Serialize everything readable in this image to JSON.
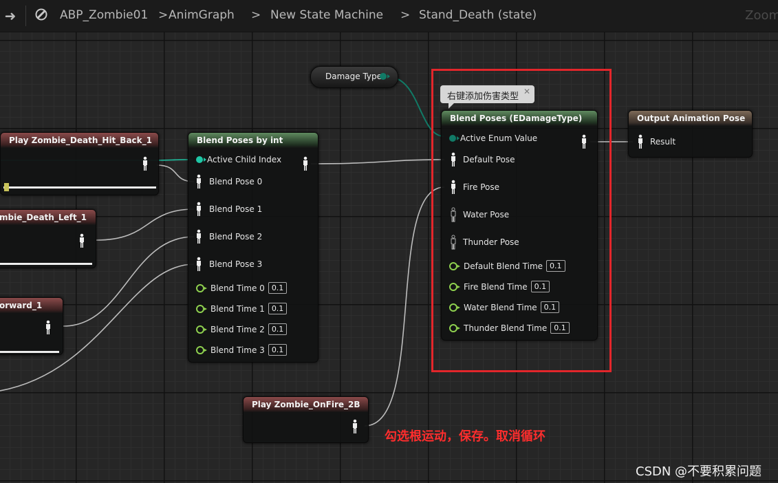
{
  "breadcrumb": {
    "items": [
      "ABP_Zombie01",
      "AnimGraph",
      "New State Machine",
      "Stand_Death (state)"
    ],
    "separator": ">",
    "zoom_label": "Zoom"
  },
  "icons": {
    "back": "back-arrow-icon",
    "blueprint": "blueprint-icon",
    "pose_pin": "pose-figure-icon",
    "exec_ring": "float-ring-pin-icon",
    "enum_dot": "enum-dot-pin-icon"
  },
  "colors": {
    "enum_pin": "#1fc7a6",
    "float_pin": "#8fd14f",
    "highlight_box": "#e3262b",
    "annotation_text": "#ff2d2d"
  },
  "variable_node": {
    "label": "Damage Type"
  },
  "comment_bubble": {
    "text": "右键添加伤害类型"
  },
  "nodes": {
    "hit_back": {
      "title": "Play Zombie_Death_Hit_Back_1"
    },
    "left": {
      "title": "mbie_Death_Left_1"
    },
    "forward": {
      "title": "orward_1"
    },
    "on_fire": {
      "title": "Play Zombie_OnFire_2B"
    },
    "blend_int": {
      "title": "Blend Poses by int",
      "index_pin": "Active Child Index",
      "poses": [
        "Blend Pose 0",
        "Blend Pose 1",
        "Blend Pose 2",
        "Blend Pose 3"
      ],
      "times": [
        {
          "label": "Blend Time 0",
          "value": "0.1"
        },
        {
          "label": "Blend Time 1",
          "value": "0.1"
        },
        {
          "label": "Blend Time 2",
          "value": "0.1"
        },
        {
          "label": "Blend Time 3",
          "value": "0.1"
        }
      ]
    },
    "blend_enum": {
      "title": "Blend Poses (EDamageType)",
      "enum_pin": "Active Enum Value",
      "poses": [
        "Default Pose",
        "Fire Pose",
        "Water Pose",
        "Thunder Pose"
      ],
      "times": [
        {
          "label": "Default Blend Time",
          "value": "0.1"
        },
        {
          "label": "Fire Blend Time",
          "value": "0.1"
        },
        {
          "label": "Water Blend Time",
          "value": "0.1"
        },
        {
          "label": "Thunder Blend Time",
          "value": "0.1"
        }
      ]
    },
    "output": {
      "title": "Output Animation Pose",
      "result_pin": "Result"
    }
  },
  "annotation": {
    "text": "勾选根运动，保存。取消循环"
  },
  "watermark": {
    "text": "CSDN @不要积累问题"
  }
}
